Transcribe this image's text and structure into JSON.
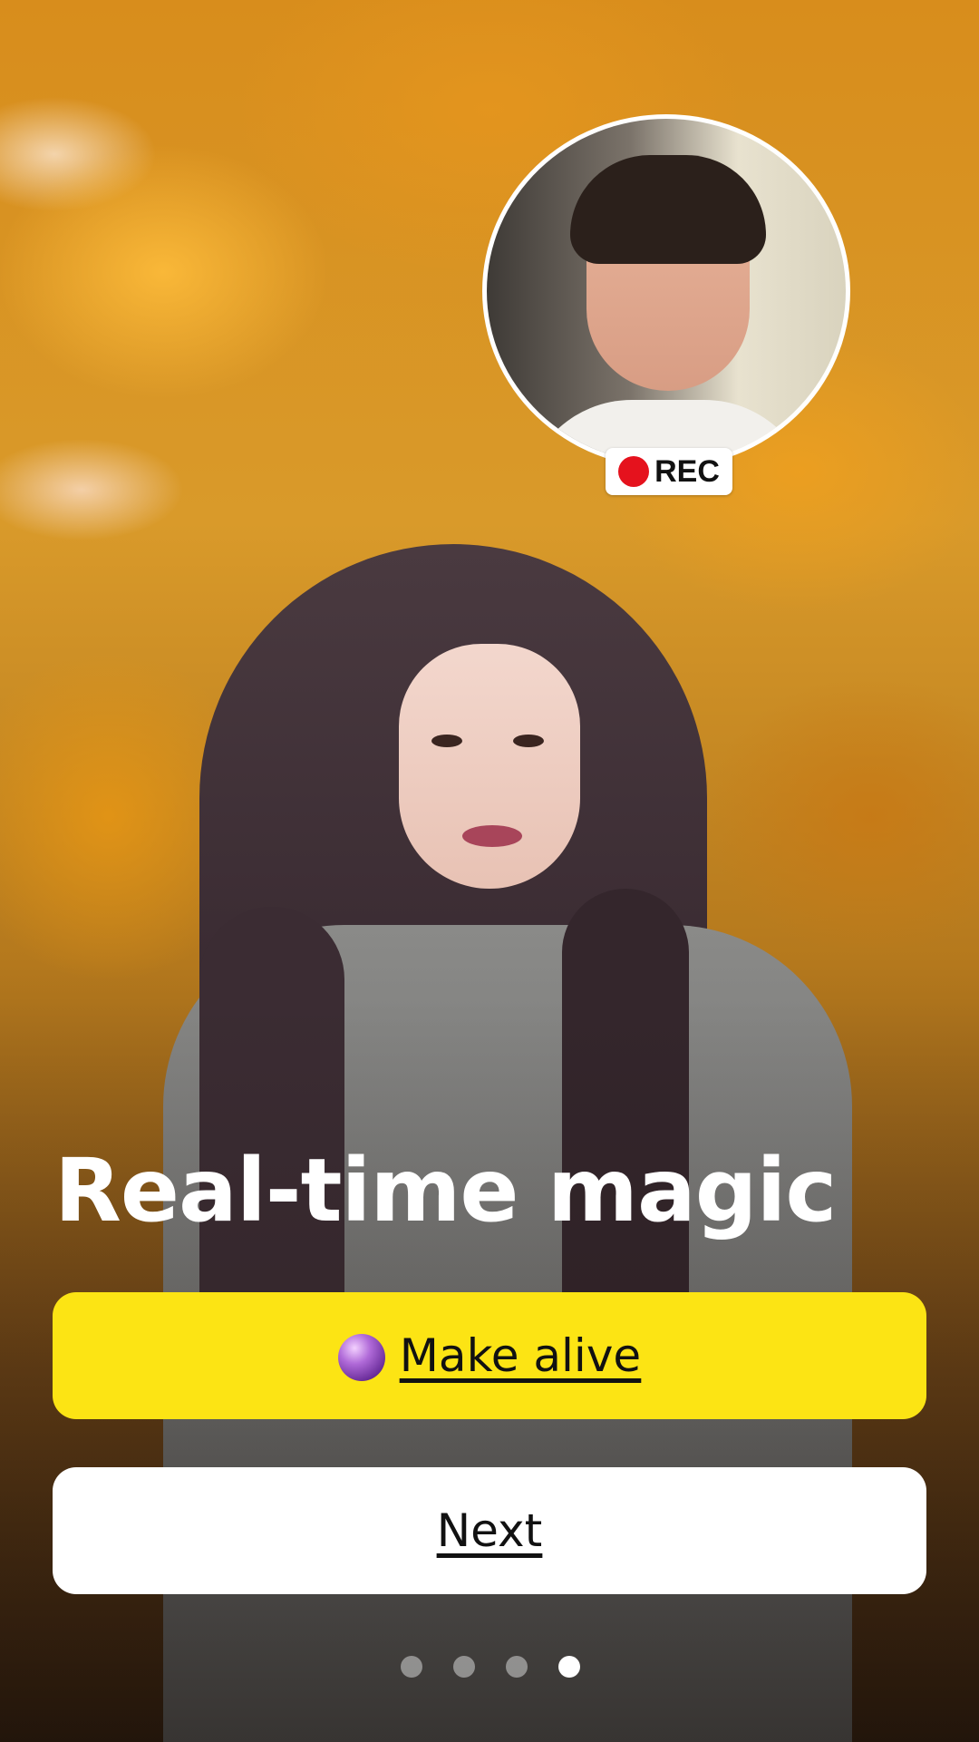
{
  "screen": {
    "title": "Real-time magic"
  },
  "selfie": {
    "badge_label": "REC",
    "badge_dot_color": "#e5121d"
  },
  "buttons": {
    "make_alive": {
      "icon": "crystal-ball-icon",
      "label": "Make alive",
      "color": "#fce414"
    },
    "next": {
      "label": "Next",
      "color": "#ffffff"
    }
  },
  "pagination": {
    "total": 4,
    "active_index": 3
  }
}
